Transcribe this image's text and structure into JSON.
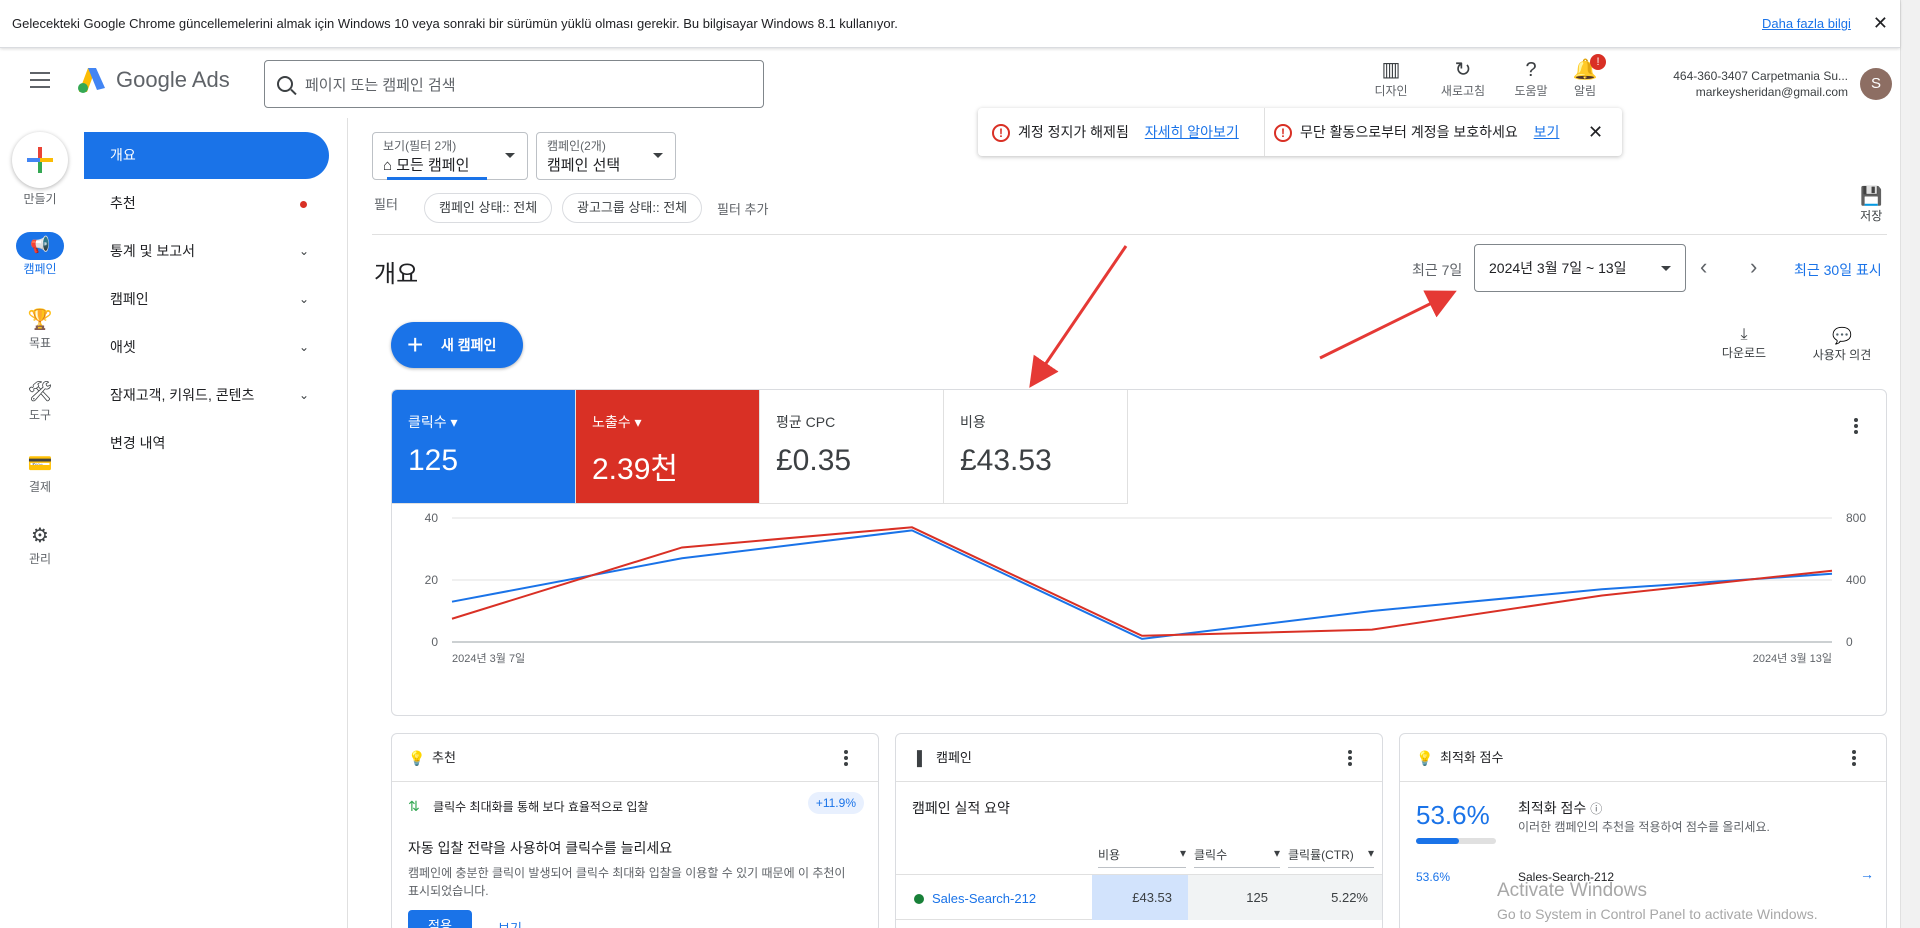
{
  "notice": {
    "message": "Gelecekteki Google Chrome güncellemelerini almak için Windows 10 veya sonraki bir sürümün yüklü olması gerekir. Bu bilgisayar Windows 8.1 kullanıyor.",
    "link": "Daha fazla bilgi",
    "close": "✕"
  },
  "header": {
    "logo_text": "Google Ads",
    "search_placeholder": "페이지 또는 캠페인 검색",
    "tools": [
      {
        "label": "디자인",
        "icon": "▥"
      },
      {
        "label": "새로고침",
        "icon": "↻"
      },
      {
        "label": "도움말",
        "icon": "?"
      },
      {
        "label": "알림",
        "icon": "🔔",
        "badge": "!"
      }
    ],
    "account_name": "464-360-3407 Carpetmania Su...",
    "account_email": "markeysheridan@gmail.com",
    "avatar_letter": "S"
  },
  "rail": {
    "create": "만들기",
    "items": [
      "캠페인",
      "목표",
      "도구",
      "결제",
      "관리"
    ]
  },
  "nav": {
    "items": [
      "개요",
      "추천",
      "통계 및 보고서",
      "캠페인",
      "애셋",
      "잠재고객, 키워드, 콘텐츠",
      "변경 내역"
    ]
  },
  "filters": {
    "view_small": "보기(필터 2개)",
    "view_value": "모든 캠페인",
    "campaign_small": "캠페인(2개)",
    "campaign_value": "캠페인 선택",
    "filter_label": "필터",
    "chip1": "캠페인 상태:: 전체",
    "chip2": "광고그룹 상태:: 전체",
    "add_filter": "필터 추가",
    "save": "저장"
  },
  "alerts": {
    "a1_text": "계정 정지가 해제됨",
    "a1_link": "자세히 알아보기",
    "a2_text": "무단 활동으로부터 계정을 보호하세요",
    "a2_link": "보기",
    "close": "✕"
  },
  "overview": {
    "title": "개요",
    "recent_label": "최근 7일",
    "date_range": "2024년 3월 7일 ~ 13일",
    "show_30": "최근 30일 표시",
    "new_campaign": "새 캠페인",
    "download": "다운로드",
    "feedback": "사용자 의견"
  },
  "metrics": [
    {
      "label": "클릭수",
      "value": "125",
      "color": "#1a73e8"
    },
    {
      "label": "노출수",
      "value": "2.39천",
      "color": "#d93025"
    },
    {
      "label": "평균 CPC",
      "value": "£0.35"
    },
    {
      "label": "비용",
      "value": "£43.53"
    }
  ],
  "chart_data": {
    "type": "line",
    "x": [
      "2024년 3월 7일",
      "2024년 3월 8일",
      "2024년 3월 9일",
      "2024년 3월 10일",
      "2024년 3월 11일",
      "2024년 3월 12일",
      "2024년 3월 13일"
    ],
    "x_tick_labels": [
      "2024년 3월 7일",
      "2024년 3월 13일"
    ],
    "series": [
      {
        "name": "클릭수",
        "axis": "left",
        "color": "#1a73e8",
        "values": [
          13,
          27,
          36,
          1,
          10,
          17,
          22
        ]
      },
      {
        "name": "노출수",
        "axis": "right",
        "color": "#d93025",
        "values": [
          150,
          610,
          740,
          40,
          80,
          300,
          460
        ]
      }
    ],
    "ylim_left": [
      0,
      40
    ],
    "yticks_left": [
      "0",
      "20",
      "40"
    ],
    "ylim_right": [
      0,
      800
    ],
    "yticks_right": [
      "0",
      "400",
      "800"
    ],
    "grid": true
  },
  "cards": {
    "rec": {
      "title": "추천",
      "item": "클릭수 최대화를 통해 보다 효율적으로 입찰",
      "badge": "+11.9%",
      "headline": "자동 입찰 전략을 사용하여 클릭수를 늘리세요",
      "desc": "캠페인에 충분한 클릭이 발생되어 클릭수 최대화 입찰을 이용할 수 있기 때문에 이 추천이 표시되었습니다.",
      "apply": "적용",
      "view": "보기"
    },
    "camp": {
      "title": "캠페인",
      "subtitle": "캠페인 실적 요약",
      "cols": [
        "비용",
        "클릭수",
        "클릭률(CTR)"
      ],
      "row": {
        "name": "Sales-Search-212",
        "cost": "£43.53",
        "clicks": "125",
        "ctr": "5.22%"
      }
    },
    "opt": {
      "title": "최적화 점수",
      "score": "53.6%",
      "score_fraction": 0.536,
      "heading": "최적화 점수",
      "desc": "이러한 캠페인의 추천을 적용하여 점수를 올리세요.",
      "row_score": "53.6%",
      "row_name": "Sales-Search-212"
    }
  },
  "watermark": {
    "title": "Activate Windows",
    "sub": "Go to System in Control Panel to activate Windows."
  }
}
